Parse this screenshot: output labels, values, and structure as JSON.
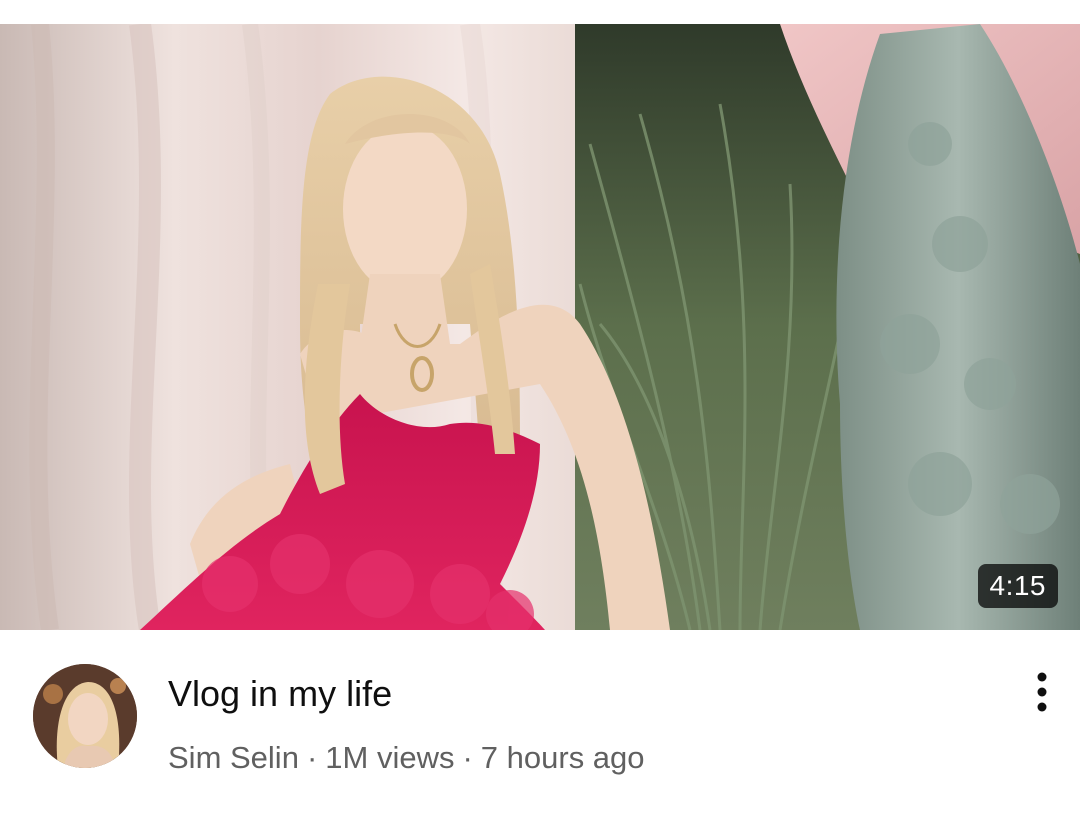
{
  "video": {
    "duration": "4:15",
    "title": "Vlog in my life",
    "channel": "Sim Selin",
    "views": "1M views",
    "age": "7 hours ago",
    "separator": "·",
    "more_icon": "more-vert-icon"
  },
  "colors": {
    "title": "#0f0f0f",
    "secondary_text": "#606060",
    "duration_bg": "#000000",
    "dress": "#d81b5a"
  }
}
